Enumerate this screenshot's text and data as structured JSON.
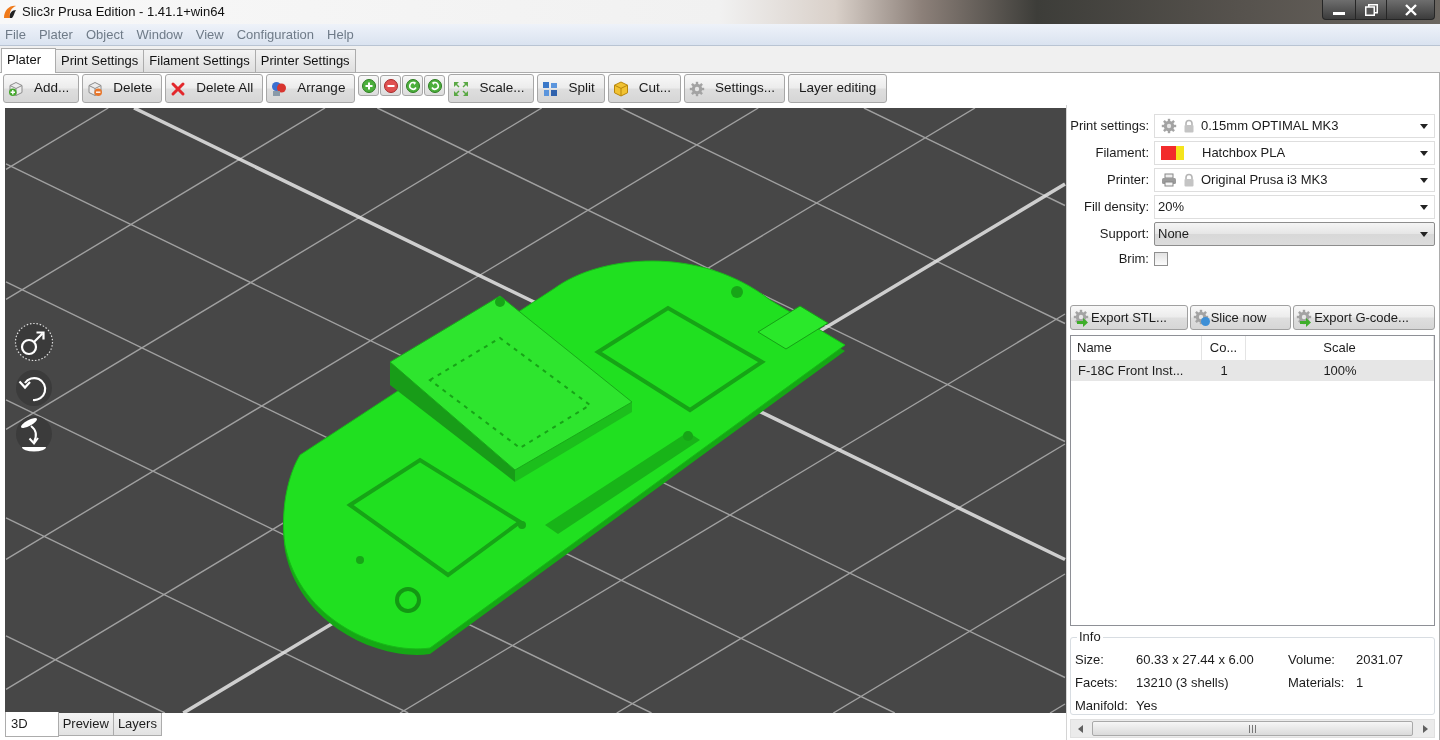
{
  "window": {
    "title": "Slic3r Prusa Edition - 1.41.1+win64"
  },
  "menu": [
    {
      "label": "File"
    },
    {
      "label": "Plater"
    },
    {
      "label": "Object"
    },
    {
      "label": "Window"
    },
    {
      "label": "View"
    },
    {
      "label": "Configuration"
    },
    {
      "label": "Help"
    }
  ],
  "tabs": [
    {
      "label": "Plater",
      "selected": true
    },
    {
      "label": "Print Settings",
      "selected": false
    },
    {
      "label": "Filament Settings",
      "selected": false
    },
    {
      "label": "Printer Settings",
      "selected": false
    }
  ],
  "toolbar": [
    {
      "kind": "button",
      "label": "Add..."
    },
    {
      "kind": "button",
      "label": "Delete"
    },
    {
      "kind": "button",
      "label": "Delete All"
    },
    {
      "kind": "button",
      "label": "Arrange"
    },
    {
      "kind": "round"
    },
    {
      "kind": "round"
    },
    {
      "kind": "round"
    },
    {
      "kind": "round"
    },
    {
      "kind": "button",
      "label": "Scale..."
    },
    {
      "kind": "button",
      "label": "Split"
    },
    {
      "kind": "button",
      "label": "Cut..."
    },
    {
      "kind": "button",
      "label": "Settings..."
    },
    {
      "kind": "button",
      "label": "Layer editing"
    }
  ],
  "settings": [
    {
      "kind": "preset",
      "label": "Print settings:",
      "value": "0.15mm OPTIMAL MK3",
      "locked": true
    },
    {
      "kind": "filament",
      "label": "Filament:",
      "value": "Hatchbox PLA",
      "swatches": [
        {
          "color": "#f22b2b"
        },
        {
          "color": "#f5e41c"
        }
      ]
    },
    {
      "kind": "printer",
      "label": "Printer:",
      "value": "Original Prusa i3 MK3",
      "locked": true
    },
    {
      "kind": "combo",
      "label": "Fill density:",
      "value": "20%"
    },
    {
      "kind": "choice",
      "label": "Support:",
      "value": "None"
    },
    {
      "kind": "checkbox",
      "label": "Brim:",
      "checked": false
    }
  ],
  "actions": [
    {
      "label": "Export STL..."
    },
    {
      "label": "Slice now"
    },
    {
      "label": "Export G-code..."
    }
  ],
  "objects": {
    "columns": [
      "Name",
      "Co...",
      "Scale"
    ],
    "rows": [
      {
        "selected": true,
        "cells": [
          "F-18C Front Inst...",
          "1",
          "100%"
        ]
      }
    ]
  },
  "info": {
    "title": "Info",
    "rows": [
      [
        {
          "label": "Size:",
          "value": "60.33 x 27.44 x 6.00"
        },
        {
          "label": "Volume:",
          "value": "2031.07"
        }
      ],
      [
        {
          "label": "Facets:",
          "value": "13210 (3 shells)"
        },
        {
          "label": "Materials:",
          "value": "1"
        }
      ],
      [
        {
          "label": "Manifold:",
          "value": "Yes"
        }
      ]
    ]
  },
  "view_tabs": [
    {
      "label": "3D",
      "selected": true
    },
    {
      "label": "Preview",
      "selected": false
    },
    {
      "label": "Layers",
      "selected": false
    }
  ]
}
